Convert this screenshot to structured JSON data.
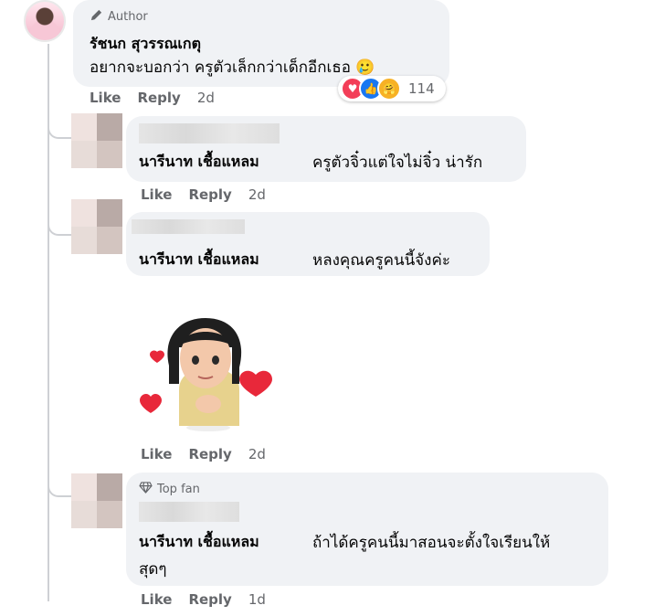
{
  "comment": {
    "badge": "Author",
    "name": "รัชนก สุวรรณเกตุ",
    "text": "อยากจะบอกว่า ครูตัวเล็กกว่าเด็กอีกเธอ 🥲",
    "like": "Like",
    "reply": "Reply",
    "time": "2d",
    "reaction_count": "114",
    "reactions": [
      "love-icon",
      "like-icon",
      "care-icon"
    ]
  },
  "replies": [
    {
      "name": "นารีนาท เชื้อแหลม",
      "text": "ครูตัวจิ๋วแต่ใจไม่จิ๋ว น่ารัก",
      "like": "Like",
      "reply": "Reply",
      "time": "2d"
    },
    {
      "name": "นารีนาท เชื้อแหลม",
      "text": "หลงคุณครูคนนี้จังค่ะ",
      "like": "Like",
      "reply": "Reply",
      "time": "2d"
    },
    {
      "badge": "Top fan",
      "name": "นารีนาท เชื้อแหลม",
      "text": "ถ้าได้ครูคนนี้มาสอนจะตั้งใจเรียนให้",
      "text2": "สุดๆ",
      "like": "Like",
      "reply": "Reply",
      "time": "1d"
    }
  ],
  "colors": {
    "bubble": "#f0f2f5",
    "meta": "#65676b",
    "heart": "#e8283a"
  }
}
